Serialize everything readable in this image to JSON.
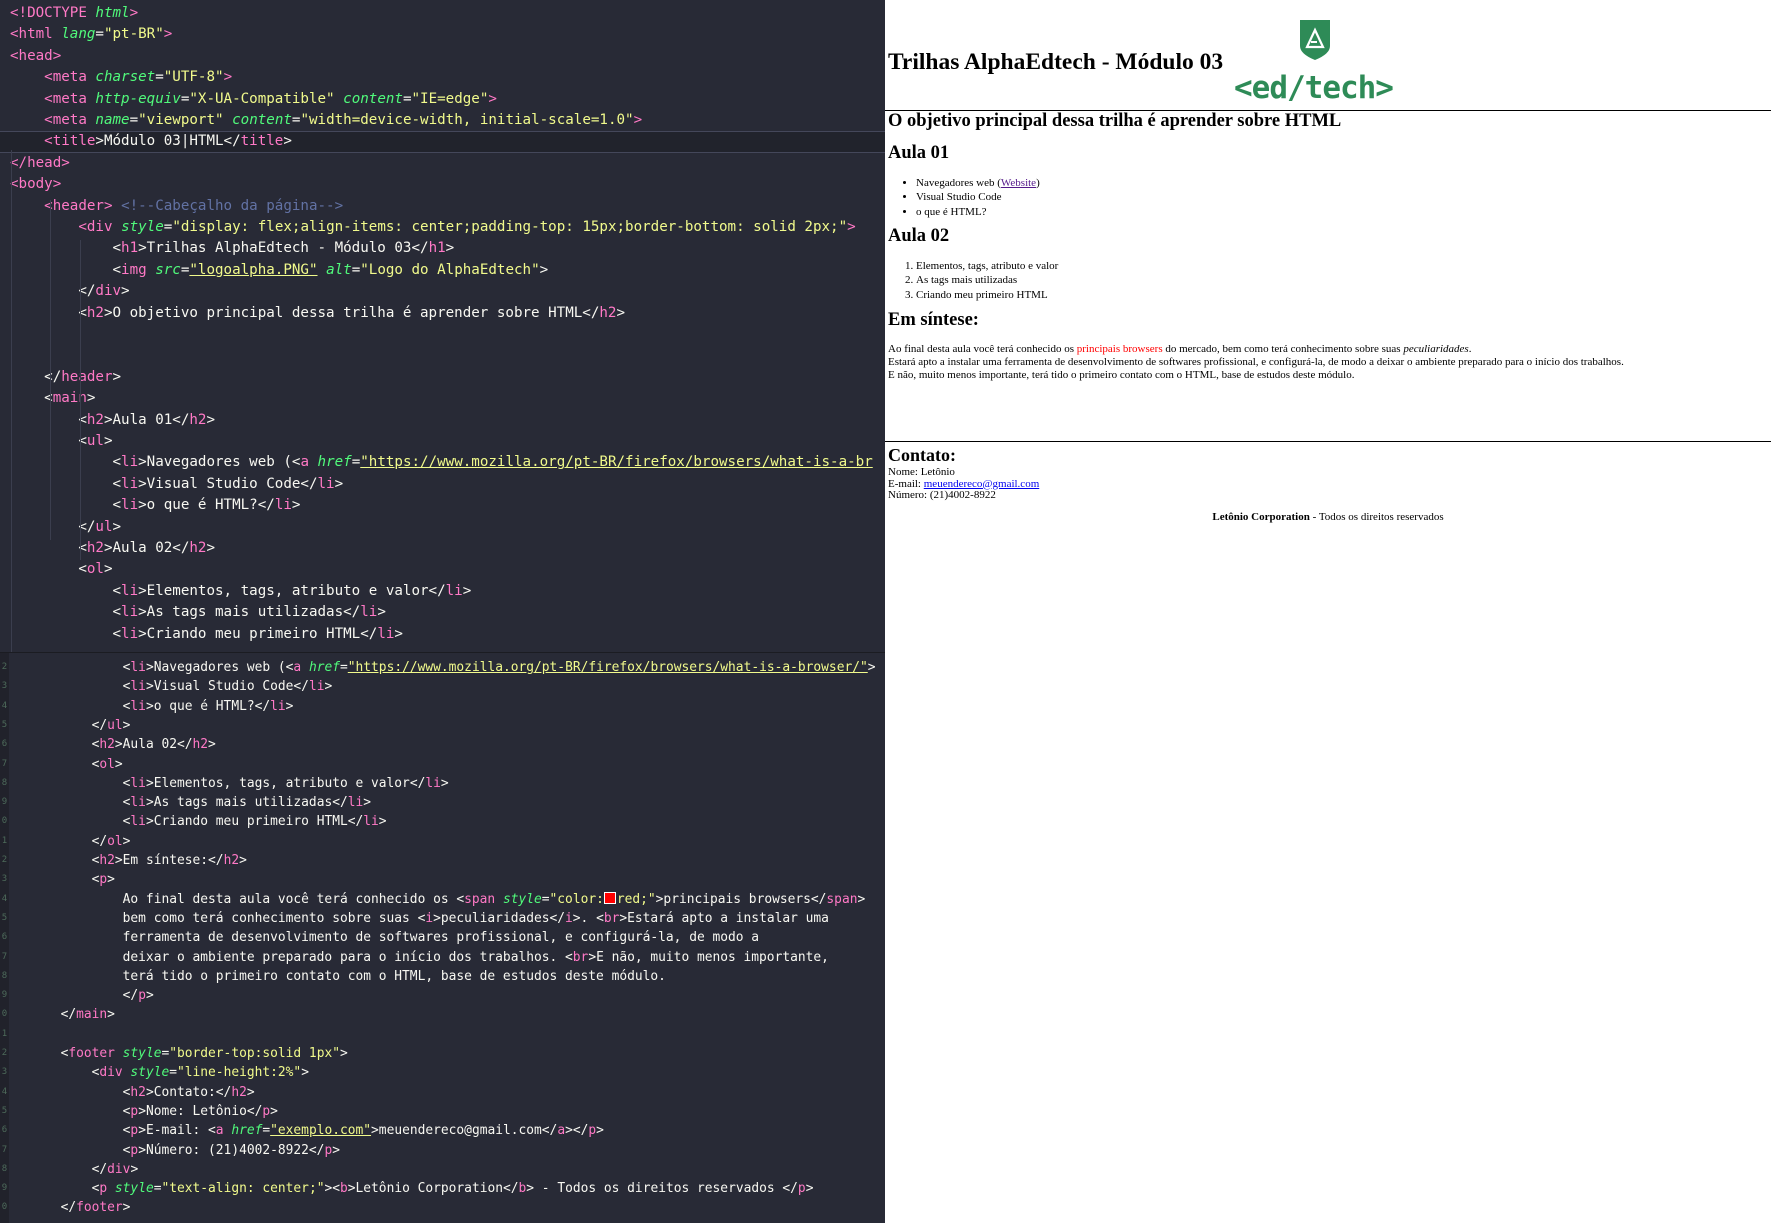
{
  "editor": {
    "pane1": [
      [
        [
          "t",
          "<!DOCTYPE "
        ],
        [
          "a",
          "html"
        ],
        [
          "t",
          ">"
        ]
      ],
      [
        [
          "t",
          "<html "
        ],
        [
          "a",
          "lang"
        ],
        [
          "p",
          "="
        ],
        [
          "s",
          "\"pt-BR\""
        ],
        [
          "t",
          ">"
        ]
      ],
      [
        [
          "t",
          "<head>"
        ]
      ],
      [
        [
          "p",
          "    "
        ],
        [
          "t",
          "<meta "
        ],
        [
          "a",
          "charset"
        ],
        [
          "p",
          "="
        ],
        [
          "s",
          "\"UTF-8\""
        ],
        [
          "t",
          ">"
        ]
      ],
      [
        [
          "p",
          "    "
        ],
        [
          "t",
          "<meta "
        ],
        [
          "a",
          "http-equiv"
        ],
        [
          "p",
          "="
        ],
        [
          "s",
          "\"X-UA-Compatible\""
        ],
        [
          "p",
          " "
        ],
        [
          "a",
          "content"
        ],
        [
          "p",
          "="
        ],
        [
          "s",
          "\"IE=edge\""
        ],
        [
          "t",
          ">"
        ]
      ],
      [
        [
          "p",
          "    "
        ],
        [
          "t",
          "<meta "
        ],
        [
          "a",
          "name"
        ],
        [
          "p",
          "="
        ],
        [
          "s",
          "\"viewport\""
        ],
        [
          "p",
          " "
        ],
        [
          "a",
          "content"
        ],
        [
          "p",
          "="
        ],
        [
          "s",
          "\"width=device-width, initial-scale=1.0\""
        ],
        [
          "t",
          ">"
        ]
      ],
      [
        [
          "p",
          "    "
        ],
        [
          "t",
          "<title"
        ],
        [
          "p",
          ">Módulo 03|HTML</"
        ],
        [
          "t",
          "title"
        ],
        [
          "p",
          ">"
        ]
      ],
      [
        [
          "t",
          "</head>"
        ]
      ],
      [
        [
          "t",
          "<body>"
        ]
      ],
      [
        [
          "p",
          "    "
        ],
        [
          "t",
          "<header"
        ],
        [
          "t",
          ">"
        ],
        [
          "p",
          " "
        ],
        [
          "c",
          "<!--Cabeçalho da página-->"
        ]
      ],
      [
        [
          "p",
          "        "
        ],
        [
          "t",
          "<div "
        ],
        [
          "a",
          "style"
        ],
        [
          "p",
          "="
        ],
        [
          "s",
          "\"display: flex;align-items: center;padding-top: 15px;border-bottom: solid 2px;\""
        ],
        [
          "t",
          ">"
        ]
      ],
      [
        [
          "p",
          "            <"
        ],
        [
          "t",
          "h1"
        ],
        [
          "p",
          ">Trilhas AlphaEdtech - Módulo 03</"
        ],
        [
          "t",
          "h1"
        ],
        [
          "p",
          ">"
        ]
      ],
      [
        [
          "p",
          "            <"
        ],
        [
          "t",
          "img "
        ],
        [
          "a",
          "src"
        ],
        [
          "p",
          "="
        ],
        [
          "su",
          "\"logoalpha.PNG\""
        ],
        [
          "p",
          " "
        ],
        [
          "a",
          "alt"
        ],
        [
          "p",
          "="
        ],
        [
          "s",
          "\"Logo do AlphaEdtech\""
        ],
        [
          "p",
          ">"
        ]
      ],
      [
        [
          "p",
          "        </"
        ],
        [
          "t",
          "div"
        ],
        [
          "p",
          ">"
        ]
      ],
      [
        [
          "p",
          "        <"
        ],
        [
          "t",
          "h2"
        ],
        [
          "p",
          ">O objetivo principal dessa trilha é aprender sobre HTML</"
        ],
        [
          "t",
          "h2"
        ],
        [
          "p",
          ">"
        ]
      ],
      [],
      [],
      [
        [
          "p",
          "    </"
        ],
        [
          "t",
          "header"
        ],
        [
          "p",
          ">"
        ]
      ],
      [
        [
          "p",
          "    <"
        ],
        [
          "t",
          "main"
        ],
        [
          "p",
          ">"
        ]
      ],
      [
        [
          "p",
          "        <"
        ],
        [
          "t",
          "h2"
        ],
        [
          "p",
          ">Aula 01</"
        ],
        [
          "t",
          "h2"
        ],
        [
          "p",
          ">"
        ]
      ],
      [
        [
          "p",
          "        <"
        ],
        [
          "t",
          "ul"
        ],
        [
          "p",
          ">"
        ]
      ],
      [
        [
          "p",
          "            <"
        ],
        [
          "t",
          "li"
        ],
        [
          "p",
          ">Navegadores web (<"
        ],
        [
          "t",
          "a "
        ],
        [
          "a",
          "href"
        ],
        [
          "p",
          "="
        ],
        [
          "su",
          "\"https://www.mozilla.org/pt-BR/firefox/browsers/what-is-a-br"
        ]
      ],
      [
        [
          "p",
          "            <"
        ],
        [
          "t",
          "li"
        ],
        [
          "p",
          ">Visual Studio Code</"
        ],
        [
          "t",
          "li"
        ],
        [
          "p",
          ">"
        ]
      ],
      [
        [
          "p",
          "            <"
        ],
        [
          "t",
          "li"
        ],
        [
          "p",
          ">o que é HTML?</"
        ],
        [
          "t",
          "li"
        ],
        [
          "p",
          ">"
        ]
      ],
      [
        [
          "p",
          "        </"
        ],
        [
          "t",
          "ul"
        ],
        [
          "p",
          ">"
        ]
      ],
      [
        [
          "p",
          "        <"
        ],
        [
          "t",
          "h2"
        ],
        [
          "p",
          ">Aula 02</"
        ],
        [
          "t",
          "h2"
        ],
        [
          "p",
          ">"
        ]
      ],
      [
        [
          "p",
          "        <"
        ],
        [
          "t",
          "ol"
        ],
        [
          "p",
          ">"
        ]
      ],
      [
        [
          "p",
          "            <"
        ],
        [
          "t",
          "li"
        ],
        [
          "p",
          ">Elementos, tags, atributo e valor</"
        ],
        [
          "t",
          "li"
        ],
        [
          "p",
          ">"
        ]
      ],
      [
        [
          "p",
          "            <"
        ],
        [
          "t",
          "li"
        ],
        [
          "p",
          ">As tags mais utilizadas</"
        ],
        [
          "t",
          "li"
        ],
        [
          "p",
          ">"
        ]
      ],
      [
        [
          "p",
          "            <"
        ],
        [
          "t",
          "li"
        ],
        [
          "p",
          ">Criando meu primeiro HTML</"
        ],
        [
          "t",
          "li"
        ],
        [
          "p",
          ">"
        ]
      ]
    ],
    "pane2": [
      [
        [
          "p",
          "              <"
        ],
        [
          "t",
          "li"
        ],
        [
          "p",
          ">Navegadores web (<"
        ],
        [
          "t",
          "a "
        ],
        [
          "a",
          "href"
        ],
        [
          "p",
          "="
        ],
        [
          "su",
          "\"https://www.mozilla.org/pt-BR/firefox/browsers/what-is-a-browser/\""
        ],
        [
          "p",
          ">"
        ]
      ],
      [
        [
          "p",
          "              <"
        ],
        [
          "t",
          "li"
        ],
        [
          "p",
          ">Visual Studio Code</"
        ],
        [
          "t",
          "li"
        ],
        [
          "p",
          ">"
        ]
      ],
      [
        [
          "p",
          "              <"
        ],
        [
          "t",
          "li"
        ],
        [
          "p",
          ">o que é HTML?</"
        ],
        [
          "t",
          "li"
        ],
        [
          "p",
          ">"
        ]
      ],
      [
        [
          "p",
          "          </"
        ],
        [
          "t",
          "ul"
        ],
        [
          "p",
          ">"
        ]
      ],
      [
        [
          "p",
          "          <"
        ],
        [
          "t",
          "h2"
        ],
        [
          "p",
          ">Aula 02</"
        ],
        [
          "t",
          "h2"
        ],
        [
          "p",
          ">"
        ]
      ],
      [
        [
          "p",
          "          <"
        ],
        [
          "t",
          "ol"
        ],
        [
          "p",
          ">"
        ]
      ],
      [
        [
          "p",
          "              <"
        ],
        [
          "t",
          "li"
        ],
        [
          "p",
          ">Elementos, tags, atributo e valor</"
        ],
        [
          "t",
          "li"
        ],
        [
          "p",
          ">"
        ]
      ],
      [
        [
          "p",
          "              <"
        ],
        [
          "t",
          "li"
        ],
        [
          "p",
          ">As tags mais utilizadas</"
        ],
        [
          "t",
          "li"
        ],
        [
          "p",
          ">"
        ]
      ],
      [
        [
          "p",
          "              <"
        ],
        [
          "t",
          "li"
        ],
        [
          "p",
          ">Criando meu primeiro HTML</"
        ],
        [
          "t",
          "li"
        ],
        [
          "p",
          ">"
        ]
      ],
      [
        [
          "p",
          "          </"
        ],
        [
          "t",
          "ol"
        ],
        [
          "p",
          ">"
        ]
      ],
      [
        [
          "p",
          "          <"
        ],
        [
          "t",
          "h2"
        ],
        [
          "p",
          ">Em síntese:</"
        ],
        [
          "t",
          "h2"
        ],
        [
          "p",
          ">"
        ]
      ],
      [
        [
          "p",
          "          <"
        ],
        [
          "t",
          "p"
        ],
        [
          "p",
          ">"
        ]
      ],
      [
        [
          "p",
          "              Ao final desta aula você terá conhecido os <"
        ],
        [
          "t",
          "span "
        ],
        [
          "a",
          "style"
        ],
        [
          "p",
          "="
        ],
        [
          "s",
          "\"color:"
        ],
        [
          "sw",
          ""
        ],
        [
          "s",
          "red;\""
        ],
        [
          "p",
          ">principais browsers</"
        ],
        [
          "t",
          "span"
        ],
        [
          "p",
          ">"
        ]
      ],
      [
        [
          "p",
          "              bem como terá conhecimento sobre suas <"
        ],
        [
          "t",
          "i"
        ],
        [
          "p",
          ">peculiaridades</"
        ],
        [
          "t",
          "i"
        ],
        [
          "p",
          ">. <"
        ],
        [
          "t",
          "br"
        ],
        [
          "p",
          ">Estará apto a instalar uma"
        ]
      ],
      [
        [
          "p",
          "              ferramenta de desenvolvimento de softwares profissional, e configurá-la, de modo a"
        ]
      ],
      [
        [
          "p",
          "              deixar o ambiente preparado para o início dos trabalhos. <"
        ],
        [
          "t",
          "br"
        ],
        [
          "p",
          ">E não, muito menos importante,"
        ]
      ],
      [
        [
          "p",
          "              terá tido o primeiro contato com o HTML, base de estudos deste módulo."
        ]
      ],
      [
        [
          "p",
          "              </"
        ],
        [
          "t",
          "p"
        ],
        [
          "p",
          ">"
        ]
      ],
      [
        [
          "p",
          "      </"
        ],
        [
          "t",
          "main"
        ],
        [
          "p",
          ">"
        ]
      ],
      [],
      [
        [
          "p",
          "      <"
        ],
        [
          "t",
          "footer "
        ],
        [
          "a",
          "style"
        ],
        [
          "p",
          "="
        ],
        [
          "s",
          "\"border-top:solid 1px\""
        ],
        [
          "p",
          ">"
        ]
      ],
      [
        [
          "p",
          "          <"
        ],
        [
          "t",
          "div "
        ],
        [
          "a",
          "style"
        ],
        [
          "p",
          "="
        ],
        [
          "s",
          "\"line-height:2%\""
        ],
        [
          "p",
          ">"
        ]
      ],
      [
        [
          "p",
          "              <"
        ],
        [
          "t",
          "h2"
        ],
        [
          "p",
          ">Contato:</"
        ],
        [
          "t",
          "h2"
        ],
        [
          "p",
          ">"
        ]
      ],
      [
        [
          "p",
          "              <"
        ],
        [
          "t",
          "p"
        ],
        [
          "p",
          ">Nome: Letônio</"
        ],
        [
          "t",
          "p"
        ],
        [
          "p",
          ">"
        ]
      ],
      [
        [
          "p",
          "              <"
        ],
        [
          "t",
          "p"
        ],
        [
          "p",
          ">E-mail: <"
        ],
        [
          "t",
          "a "
        ],
        [
          "a",
          "href"
        ],
        [
          "p",
          "="
        ],
        [
          "su",
          "\"exemplo.com\""
        ],
        [
          "p",
          ">meuendereco@gmail.com</"
        ],
        [
          "t",
          "a"
        ],
        [
          "p",
          "></"
        ],
        [
          "t",
          "p"
        ],
        [
          "p",
          ">"
        ]
      ],
      [
        [
          "p",
          "              <"
        ],
        [
          "t",
          "p"
        ],
        [
          "p",
          ">Número: (21)4002-8922</"
        ],
        [
          "t",
          "p"
        ],
        [
          "p",
          ">"
        ]
      ],
      [
        [
          "p",
          "          </"
        ],
        [
          "t",
          "div"
        ],
        [
          "p",
          ">"
        ]
      ],
      [
        [
          "p",
          "          <"
        ],
        [
          "t",
          "p "
        ],
        [
          "a",
          "style"
        ],
        [
          "p",
          "="
        ],
        [
          "s",
          "\"text-align: center;\""
        ],
        [
          "p",
          "><"
        ],
        [
          "t",
          "b"
        ],
        [
          "p",
          ">Letônio Corporation</"
        ],
        [
          "t",
          "b"
        ],
        [
          "p",
          "> - Todos os direitos reservados </"
        ],
        [
          "t",
          "p"
        ],
        [
          "p",
          ">"
        ]
      ],
      [
        [
          "p",
          "      </"
        ],
        [
          "t",
          "footer"
        ],
        [
          "p",
          ">"
        ]
      ]
    ],
    "pane2_gutter": [
      "2",
      "3",
      "4",
      "5",
      "6",
      "7",
      "8",
      "9",
      "0",
      "1",
      "2",
      "3",
      "4",
      "5",
      "6",
      "7",
      "8",
      "9",
      "0",
      "1",
      "2",
      "3",
      "4",
      "5",
      "6",
      "7",
      "8",
      "9",
      "0"
    ],
    "colors": {
      "tag": "#ff79c6",
      "attr": "#50fa7b",
      "string": "#f1fa8c",
      "comment": "#6272a4",
      "text": "#f8f8f2",
      "background": "#282a36"
    }
  },
  "page": {
    "h1": "Trilhas AlphaEdtech - Módulo 03",
    "logo_text": "<ed/tech>",
    "subtitle": "O objetivo principal dessa trilha é aprender sobre HTML",
    "aula01": {
      "title": "Aula 01",
      "item1_text": "Navegadores web (",
      "item1_link": "Website",
      "item1_close": ")",
      "item2": "Visual Studio Code",
      "item3": "o que é HTML?"
    },
    "aula02": {
      "title": "Aula 02",
      "items": [
        "Elementos, tags, atributo e valor",
        "As tags mais utilizadas",
        "Criando meu primeiro HTML"
      ]
    },
    "sintese": {
      "title": "Em síntese:",
      "p1_a": "Ao final desta aula você terá conhecido os ",
      "p1_red": "principais browsers",
      "p1_b": " do mercado, bem como terá conhecimento sobre suas ",
      "p1_i": "peculiaridades",
      "p1_c": ".",
      "p2": "Estará apto a instalar uma ferramenta de desenvolvimento de softwares profissional, e configurá-la, de modo a deixar o ambiente preparado para o início dos trabalhos.",
      "p3": "E não, muito menos importante, terá tido o primeiro contato com o HTML, base de estudos deste módulo."
    },
    "contato": {
      "title": "Contato:",
      "nome": "Nome: Letônio",
      "email_label": "E-mail: ",
      "email": "meuendereco@gmail.com",
      "numero": "Número: (21)4002-8922"
    },
    "footer_bold": "Letônio Corporation",
    "footer_rest": " - Todos os direitos reservados",
    "colors": {
      "logo_green": "#2e8b57",
      "highlight_red": "#ff0000",
      "link": "#0000ee",
      "visited": "#551a8b"
    }
  }
}
